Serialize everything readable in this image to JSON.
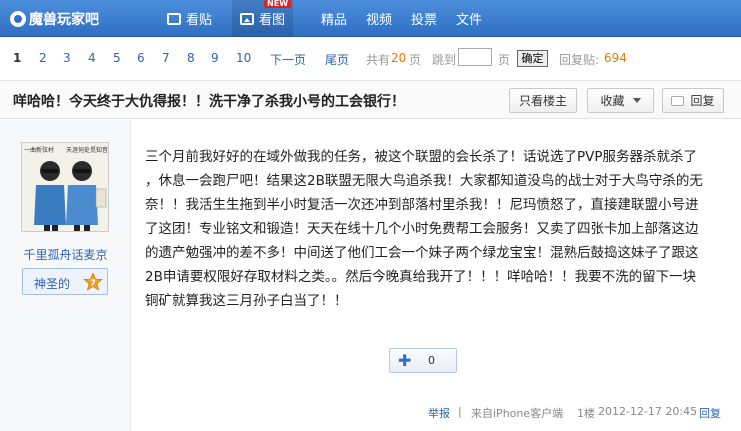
{
  "topbar": {
    "brand": "魔兽玩家吧",
    "nav": [
      {
        "label": "看贴",
        "icon": "post-icon"
      },
      {
        "label": "看图",
        "icon": "image-icon",
        "badge": "NEW"
      },
      {
        "label": "精品"
      },
      {
        "label": "视频"
      },
      {
        "label": "投票"
      },
      {
        "label": "文件"
      }
    ],
    "colors": {
      "bar": "#2f6fc4"
    }
  },
  "pager": {
    "pages": [
      "1",
      "2",
      "3",
      "4",
      "5",
      "6",
      "7",
      "8",
      "9",
      "10"
    ],
    "current": "1",
    "next": "下一页",
    "last": "尾页",
    "total_prefix": "共有",
    "total_pages": "20",
    "total_suffix": "页",
    "jump_label": "跳到",
    "jump_value": "",
    "page_unit": "页",
    "confirm": "确定",
    "reply_label": "回复贴:",
    "reply_count": "694"
  },
  "thread": {
    "title": "咩哈哈！今天终于大仇得报！！洗干净了杀我小号的工会银行！",
    "only_author": "只看楼主",
    "collect": "收藏",
    "reply": "回复"
  },
  "post": {
    "avatar_caption_left": "一曲新弦村",
    "avatar_caption_right": "天涯何处觅知音",
    "author": "千里孤舟话麦京",
    "level_name": "神圣的",
    "level_num": "7",
    "content_lines": [
      "三个月前我好好的在域外做我的任务，被这个联盟的会长杀了！话说选了PVP服务器杀就杀了",
      "，休息一会跑尸吧！结果这2B联盟无限大鸟追杀我！大家都知道没鸟的战士对于大鸟守杀的无",
      "奈！！我活生生拖到半小时复活一次还冲到部落村里杀我！！尼玛愤怒了，直接建联盟小号进",
      "了这团！专业铭文和锻造！天天在线十几个小时免费帮工会服务！又卖了四张卡加上部落这边",
      "的遗产勉强冲的差不多！中间送了他们工会一个妹子两个绿龙宝宝！混熟后鼓捣这妹子了跟这",
      "2B申请要权限好存取材料之类。。然后今晚真给我开了！！！咩哈哈！！我要不洗的留下一块",
      "铜矿就算我这三月孙子白当了！！"
    ],
    "like_count": "0",
    "report": "举报",
    "source": "来自iPhone客户端",
    "floor": "1楼",
    "time": "2012-12-17 20:45",
    "reply": "回复"
  }
}
